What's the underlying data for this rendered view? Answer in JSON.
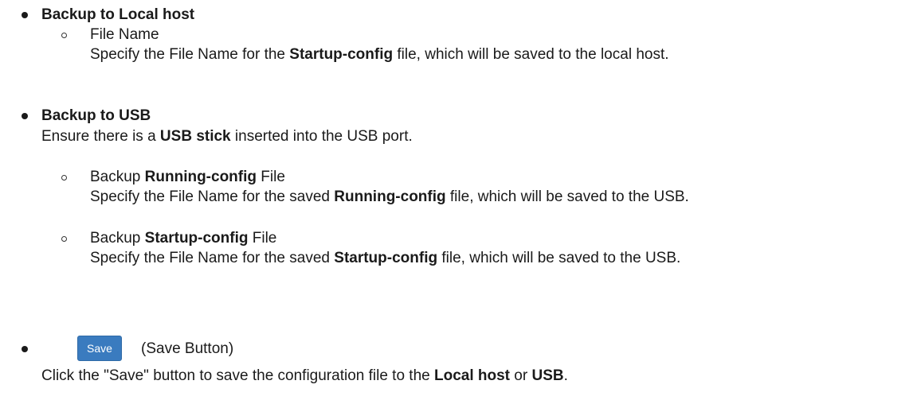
{
  "local_host": {
    "heading": "Backup to Local host",
    "file_name_label": "File Name",
    "desc_pre": "Specify the File Name for the ",
    "desc_bold": "Startup-config",
    "desc_post": " file, which will be saved to the local host."
  },
  "usb": {
    "heading": "Backup to USB",
    "ensure_pre": "Ensure there is a ",
    "ensure_bold": "USB stick",
    "ensure_post": " inserted into the USB port.",
    "running": {
      "label_pre": "Backup ",
      "label_bold": "Running-config",
      "label_post": " File",
      "desc_pre": "Specify the File Name for the saved ",
      "desc_bold": "Running-config",
      "desc_post": " file, which will be saved to the USB."
    },
    "startup": {
      "label_pre": "Backup ",
      "label_bold": "Startup-config",
      "label_post": " File",
      "desc_pre": "Specify the File Name for the saved ",
      "desc_bold": "Startup-config",
      "desc_post": " file, which will be saved to the USB."
    }
  },
  "save": {
    "button_label": "Save",
    "caption": "(Save Button)",
    "desc_pre": "Click the \"Save\" button to save the configuration file to the ",
    "desc_bold1": "Local host",
    "desc_mid": " or ",
    "desc_bold2": "USB",
    "desc_post": "."
  }
}
